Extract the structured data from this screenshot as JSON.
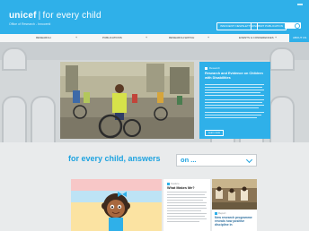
{
  "header": {
    "logo_text": "unicef",
    "tagline": "for every child",
    "subtagline": "Office of Research - Innocenti",
    "button1_label": "INNOCENTI NEWSLETTER",
    "button2_label": "SUBMIT PUBLICATION",
    "brand_color": "#2fb0e9"
  },
  "nav": {
    "items": [
      {
        "label": "RESEARCH"
      },
      {
        "label": "PUBLICATIONS"
      },
      {
        "label": "RESEARCH-WATCH"
      },
      {
        "label": "EVENTS & CONFERENCES"
      },
      {
        "label": "ABOUT US"
      }
    ]
  },
  "hero": {
    "image_alt": "children in wheelchairs playing in a school courtyard"
  },
  "feature_card": {
    "tag": "Research",
    "title": "Research and Evidence on Children with Disabilities",
    "button_label": "Learn more"
  },
  "answers": {
    "headline": "for every child, answers",
    "dropdown_value": "on ..."
  },
  "cards": [
    {
      "tag": "Feature",
      "title": "What Makes Me?"
    },
    {
      "tag": "Report",
      "title": "New research programme reveals how positive discipline in"
    }
  ]
}
